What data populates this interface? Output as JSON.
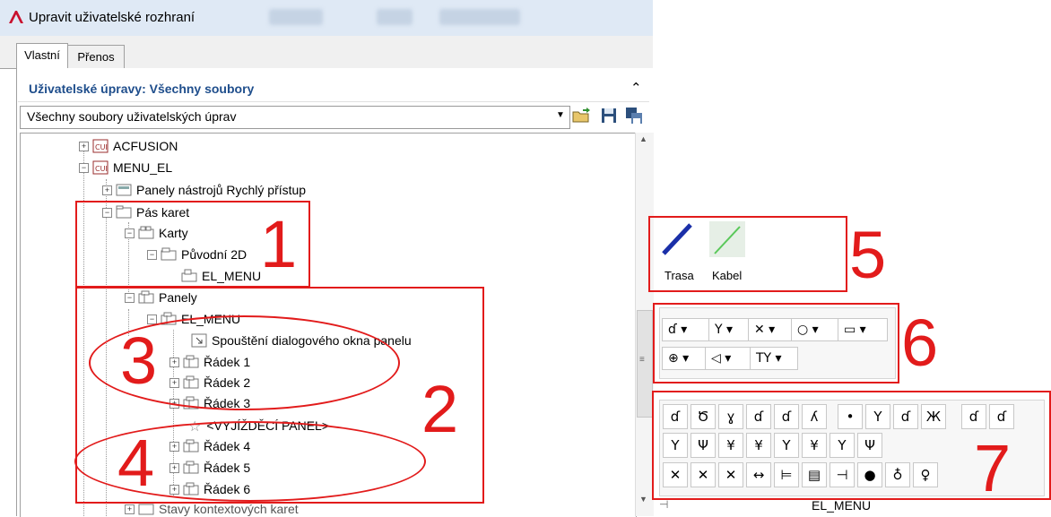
{
  "window": {
    "title": "Upravit uživatelské rozhraní"
  },
  "tabs": [
    {
      "label": "Vlastní",
      "active": true
    },
    {
      "label": "Přenos",
      "active": false
    }
  ],
  "section": {
    "title": "Uživatelské úpravy: Všechny soubory",
    "collapse_glyph": "⌃"
  },
  "filter": {
    "selected": "Všechny soubory uživatelských úprav"
  },
  "tree": [
    {
      "label": "ACFUSION",
      "icon": "cui-file-icon"
    },
    {
      "label": "MENU_EL",
      "icon": "cui-file-icon"
    },
    {
      "label": "Panely nástrojů Rychlý přístup",
      "icon": "toolbar-icon"
    },
    {
      "label": "Pás karet",
      "icon": "folder-icon"
    },
    {
      "label": "Karty",
      "icon": "tabs-icon"
    },
    {
      "label": "Původní 2D",
      "icon": "folder-icon"
    },
    {
      "label": "EL_MENU",
      "icon": "tab-icon"
    },
    {
      "label": "Panely",
      "icon": "panels-icon"
    },
    {
      "label": "EL_MENU",
      "icon": "panel-icon"
    },
    {
      "label": "Spouštění dialogového okna panelu",
      "icon": "dialog-launcher-icon"
    },
    {
      "label": "Řádek 1",
      "icon": "row-icon"
    },
    {
      "label": "Řádek 2",
      "icon": "row-icon"
    },
    {
      "label": "Řádek 3",
      "icon": "row-icon"
    },
    {
      "label": "<VYJÍŽDĚCÍ PANEL>",
      "icon": "star-icon"
    },
    {
      "label": "Řádek 4",
      "icon": "row-icon"
    },
    {
      "label": "Řádek 5",
      "icon": "row-icon"
    },
    {
      "label": "Řádek 6",
      "icon": "row-icon"
    },
    {
      "label": "Stavy kontextových karet",
      "icon": "folder-icon"
    }
  ],
  "annotations": {
    "n1": "1",
    "n2": "2",
    "n3": "3",
    "n4": "4",
    "n5": "5",
    "n6": "6",
    "n7": "7",
    "color": "#e21b1b"
  },
  "panel5": {
    "trasa": "Trasa",
    "kabel": "Kabel"
  },
  "panel6": {
    "row1": [
      "ɗ",
      "Y",
      "✕",
      "○",
      "▭"
    ],
    "row2": [
      "⊕",
      "◁",
      "TY"
    ]
  },
  "panel7": {
    "row1": [
      "ɗ",
      "Ծ",
      "ɣ",
      "ɗ",
      "ɗ",
      "ʎ",
      "•",
      "Y",
      "ɗ",
      "Ж",
      "ɗ",
      "ɗ"
    ],
    "row2": [
      "Y",
      "Ψ",
      "¥",
      "¥",
      "Y",
      "¥",
      "Y",
      "Ψ"
    ],
    "row3": [
      "✕",
      "✕",
      "✕",
      "↔",
      "⊨",
      "▤",
      "⊣",
      "●",
      "♁",
      "♀"
    ]
  },
  "bottom": {
    "label": "EL_MENU"
  }
}
